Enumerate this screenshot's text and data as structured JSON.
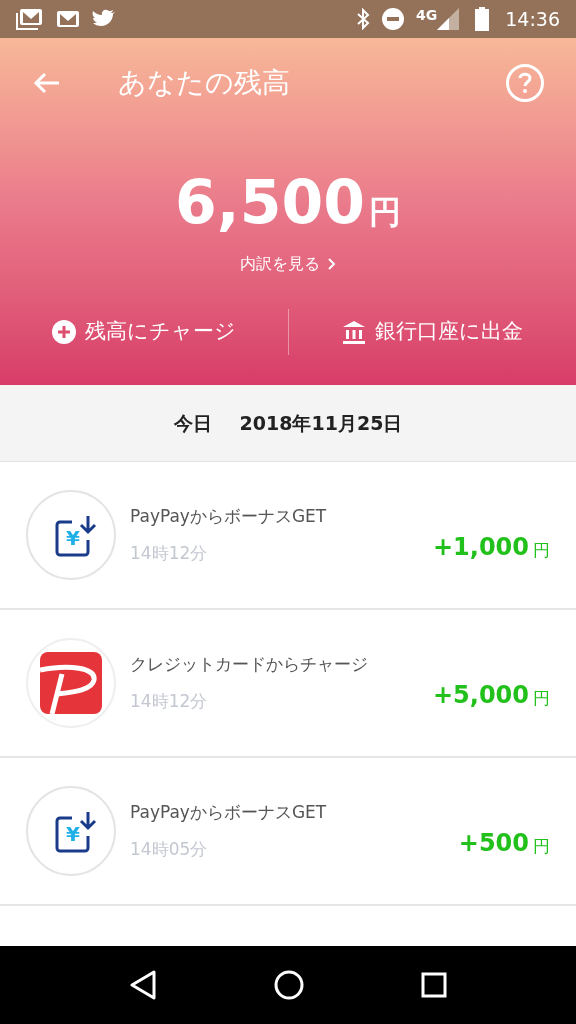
{
  "status_bar": {
    "network": "4G",
    "time": "14:36"
  },
  "header": {
    "title": "あなたの残高"
  },
  "balance": {
    "amount": "6,500",
    "currency": "円",
    "link": "内訳を見る"
  },
  "actions": [
    {
      "kind": "charge",
      "label": "残高にチャージ"
    },
    {
      "kind": "bank",
      "label": "銀行口座に出金"
    }
  ],
  "date_header": {
    "day": "今日",
    "date": "2018年11月25日"
  },
  "transactions": [
    {
      "kind": "bonus",
      "icon_text": "¥",
      "title": "PayPayからボーナスGET",
      "time": "14時12分",
      "amount": "+1,000",
      "currency": "円"
    },
    {
      "kind": "card",
      "title": "クレジットカードからチャージ",
      "time": "14時12分",
      "amount": "+5,000",
      "currency": "円"
    },
    {
      "kind": "bonus",
      "icon_text": "¥",
      "title": "PayPayからボーナスGET",
      "time": "14時05分",
      "amount": "+500",
      "currency": "円"
    }
  ]
}
